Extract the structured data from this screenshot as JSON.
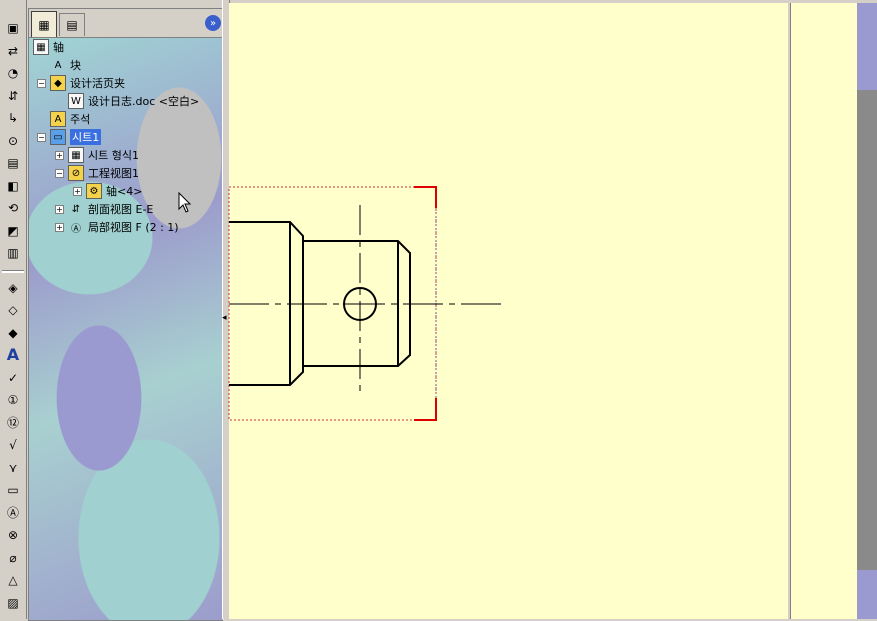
{
  "toolbar": {
    "tools": [
      "drawing-view-icon",
      "section-view-icon",
      "detail-view-icon",
      "projection-view-icon",
      "auxiliary-view-icon",
      "partial-view-icon",
      "crop-view-icon",
      "broken-view-icon",
      "alternate-view-icon",
      "relative-view-icon",
      "model-view-icon",
      "dimension-icon",
      "smart-dimension-icon",
      "model-items-icon",
      "note-icon",
      "spell-check-icon",
      "balloon-icon",
      "auto-balloon-icon",
      "surface-finish-icon",
      "weld-symbol-icon",
      "geometric-tolerance-icon",
      "datum-feature-icon",
      "datum-target-icon",
      "hole-callout-icon",
      "cosmetic-thread-icon",
      "hatch-icon"
    ]
  },
  "tree": {
    "root": "轴",
    "items": [
      {
        "label": "块",
        "indent": 1,
        "icon": "block-icon",
        "toggle": ""
      },
      {
        "label": "设计活页夹",
        "indent": 1,
        "icon": "binder-icon",
        "toggle": "−"
      },
      {
        "label": "设计日志.doc <空白>",
        "indent": 2,
        "icon": "doc-icon",
        "toggle": ""
      },
      {
        "label": "주석",
        "indent": 1,
        "icon": "annotation-icon",
        "toggle": ""
      },
      {
        "label": "시트1",
        "indent": 1,
        "icon": "sheet-icon",
        "toggle": "−",
        "selected": true
      },
      {
        "label": "시트 형식1",
        "indent": 2,
        "icon": "sheet-format-icon",
        "toggle": "+"
      },
      {
        "label": "工程视图1",
        "indent": 2,
        "icon": "drawing-view-icon",
        "toggle": "−"
      },
      {
        "label": "轴<4>",
        "indent": 3,
        "icon": "part-icon",
        "toggle": "+"
      },
      {
        "label": "剖面视图 E-E",
        "indent": 2,
        "icon": "section-view-icon",
        "toggle": "+"
      },
      {
        "label": "局部视图 F (2 : 1)",
        "indent": 2,
        "icon": "detail-view-icon",
        "toggle": "+"
      }
    ]
  },
  "colors": {
    "sheet": "#ffffcc",
    "selection": "#3a6fe0",
    "crop_border": "#dd0000",
    "view_boundary": "#cc3333"
  }
}
